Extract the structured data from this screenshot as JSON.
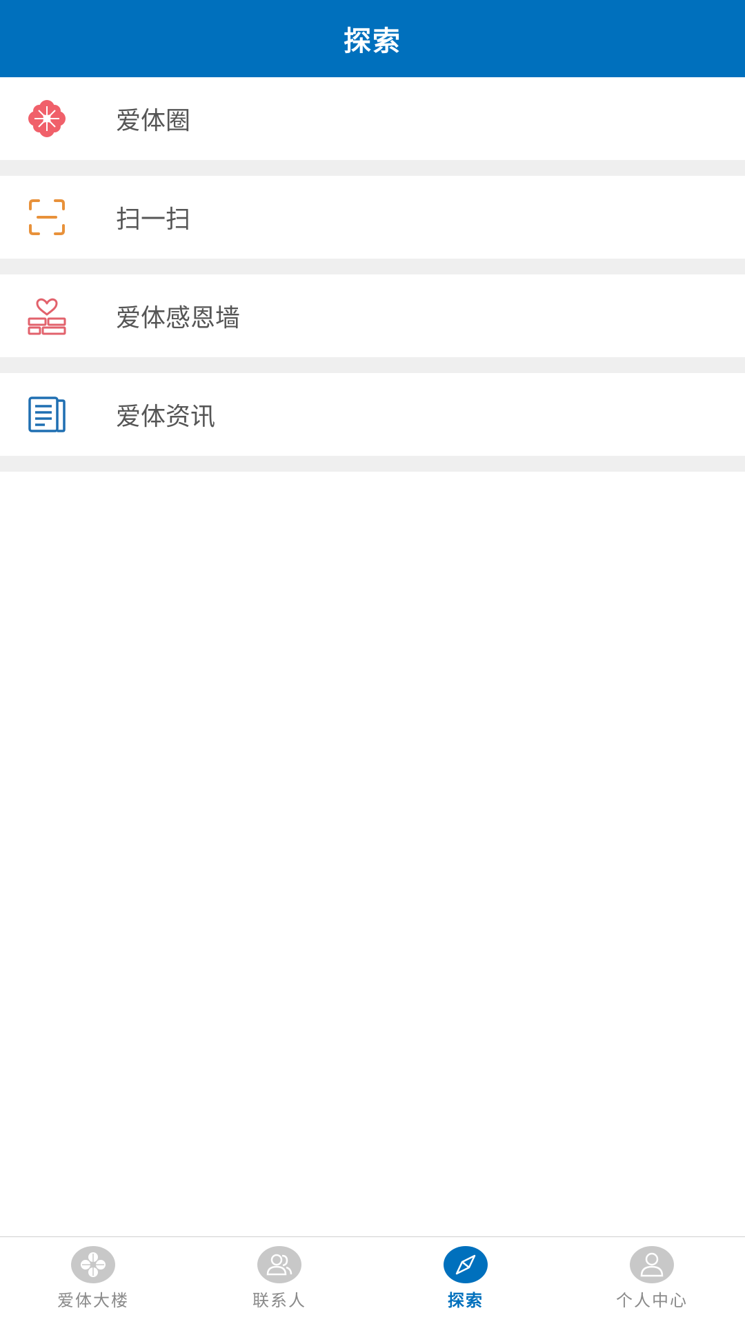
{
  "header": {
    "title": "探索"
  },
  "menu": {
    "items": [
      {
        "label": "爱体圈",
        "icon": "clover-flower-icon"
      },
      {
        "label": "扫一扫",
        "icon": "scan-icon"
      },
      {
        "label": "爱体感恩墙",
        "icon": "heart-wall-icon"
      },
      {
        "label": "爱体资讯",
        "icon": "news-icon"
      }
    ]
  },
  "tabbar": {
    "tabs": [
      {
        "label": "爱体大楼",
        "icon": "clover-icon",
        "active": false
      },
      {
        "label": "联系人",
        "icon": "contacts-icon",
        "active": false
      },
      {
        "label": "探索",
        "icon": "compass-icon",
        "active": true
      },
      {
        "label": "个人中心",
        "icon": "user-icon",
        "active": false
      }
    ]
  },
  "colors": {
    "brand": "#0070bd",
    "clover": "#f0606a",
    "scan": "#e8913a",
    "wall": "#e2626c",
    "news": "#1f6fb2",
    "inactive": "#c8c8c8"
  }
}
